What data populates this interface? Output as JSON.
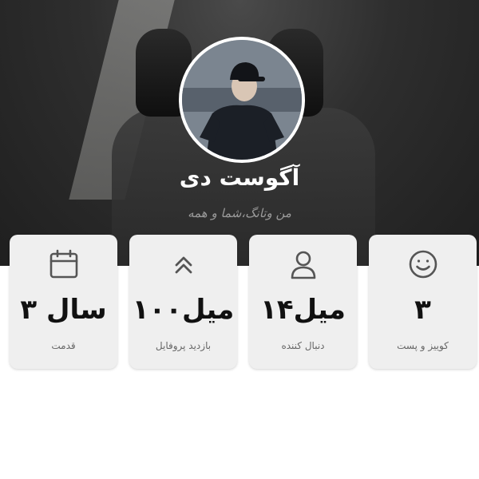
{
  "profile": {
    "name": "آگوست دی",
    "bio": "من وتانگ،شما و همه"
  },
  "stats": [
    {
      "value": "۳",
      "label": "کوییز و پست",
      "icon": "smiley-icon"
    },
    {
      "value": "۱۴میل",
      "label": "دنبال کننده",
      "icon": "user-icon"
    },
    {
      "value": "۱۰۰میل",
      "label": "بازدید پروفایل",
      "icon": "chevrons-up-icon"
    },
    {
      "value": "۳ سال",
      "label": "قدمت",
      "icon": "calendar-icon"
    }
  ],
  "colors": {
    "card_bg": "#efefef",
    "value_text": "#111111",
    "label_text": "#666666",
    "icon": "#555555"
  }
}
